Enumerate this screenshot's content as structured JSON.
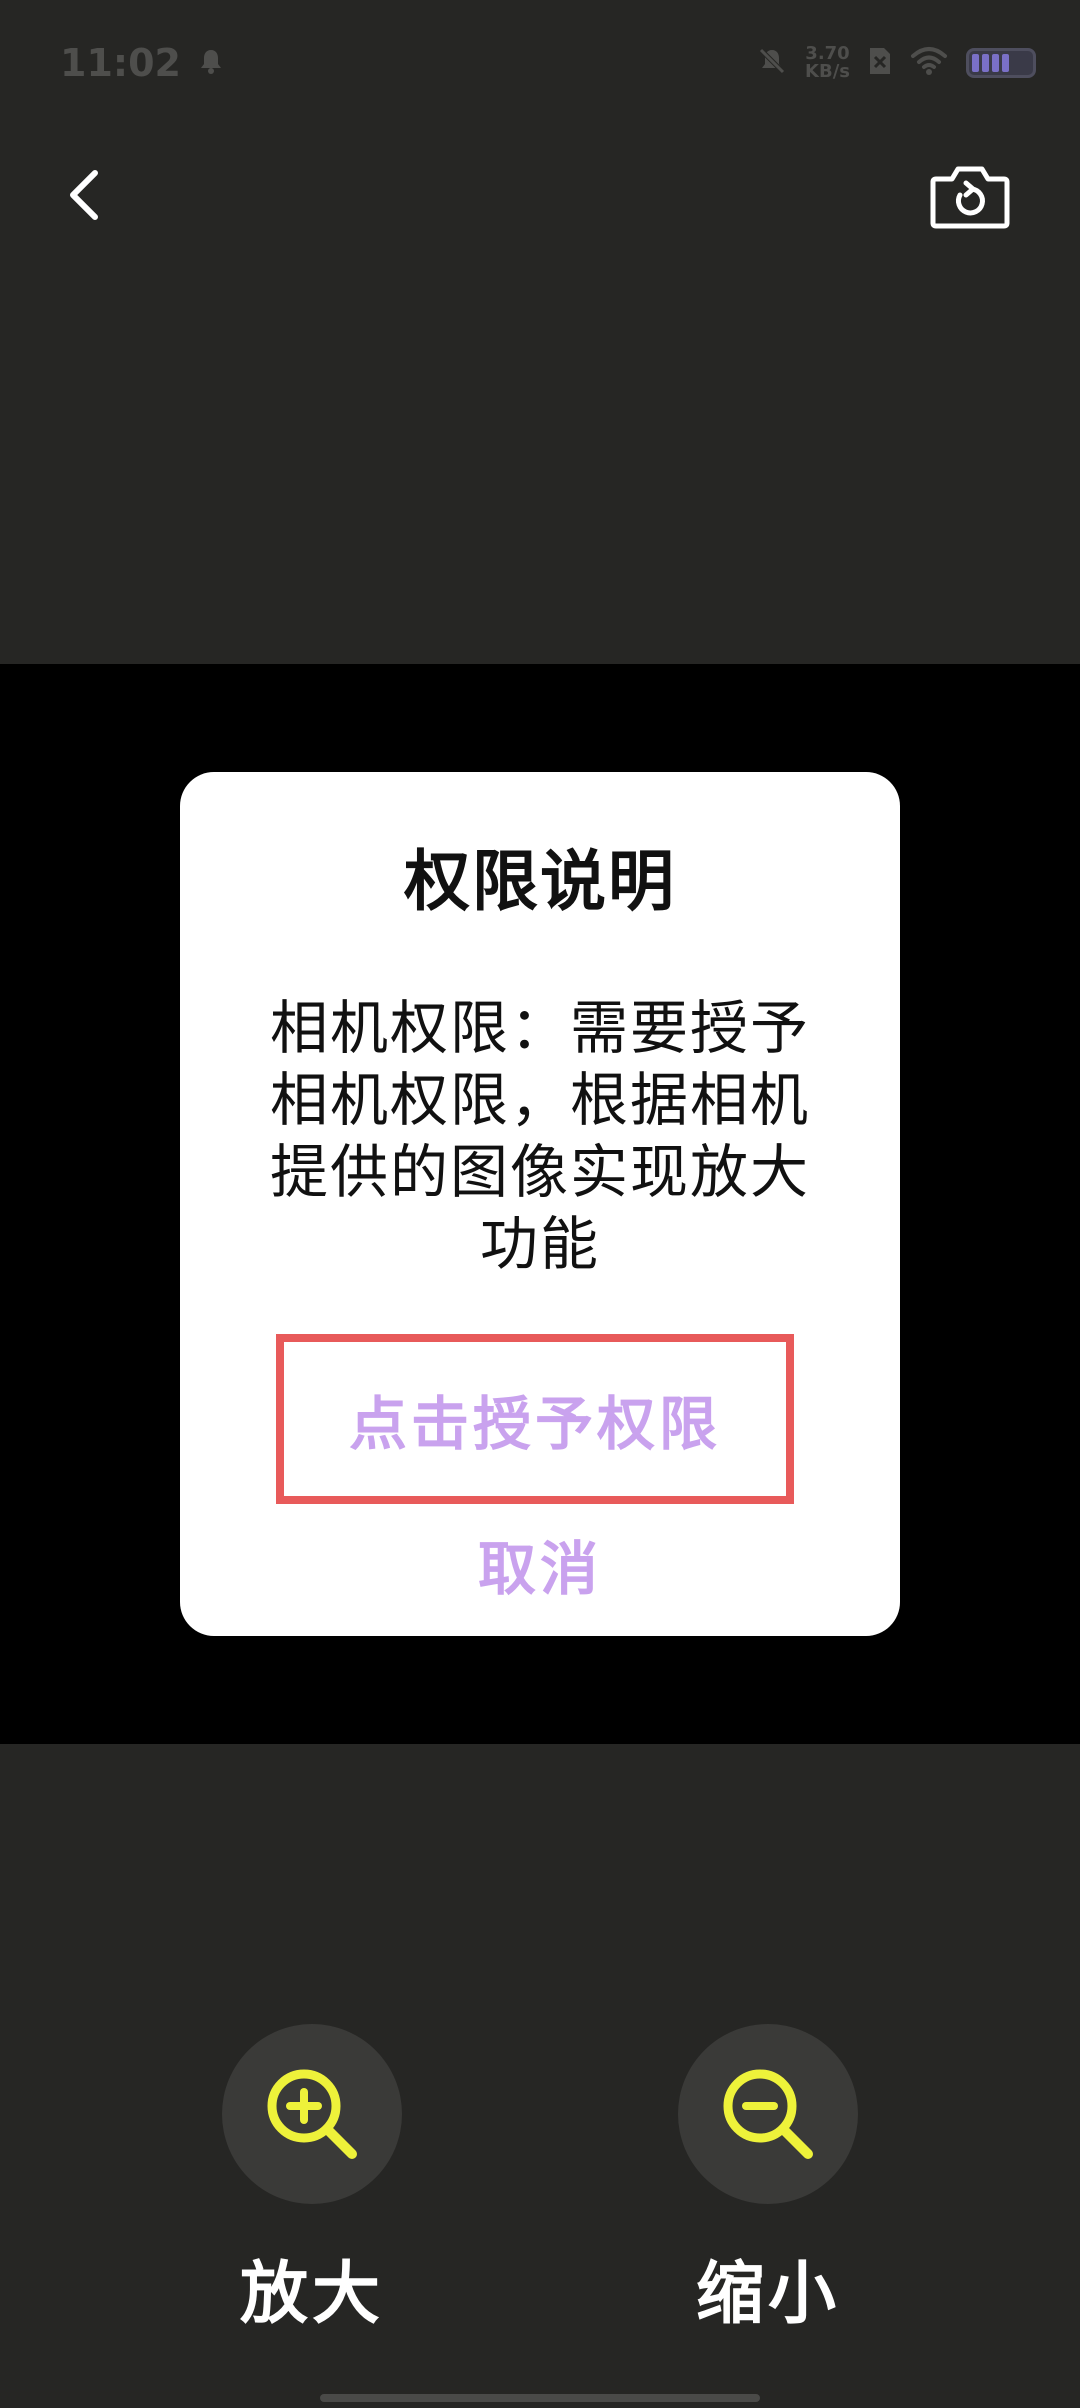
{
  "status_bar": {
    "time": "11:02",
    "net_speed_value": "3.70",
    "net_speed_unit": "KB/s",
    "icons": [
      "notification-bell-icon",
      "mute-icon",
      "sim-icon",
      "wifi-icon",
      "battery-icon"
    ]
  },
  "top_bar": {
    "back_icon": "chevron-left-icon",
    "switch_camera_icon": "switch-camera-icon"
  },
  "dialog": {
    "title": "权限说明",
    "message": "相机权限：需要授予相机权限，根据相机提供的图像实现放大功能",
    "grant_label": "点击授予权限",
    "cancel_label": "取消",
    "highlight_color": "#e85a5a",
    "action_color": "#c9a2ee"
  },
  "zoom_controls": {
    "zoom_in_label": "放大",
    "zoom_out_label": "缩小",
    "icon_color": "#eef23a"
  }
}
